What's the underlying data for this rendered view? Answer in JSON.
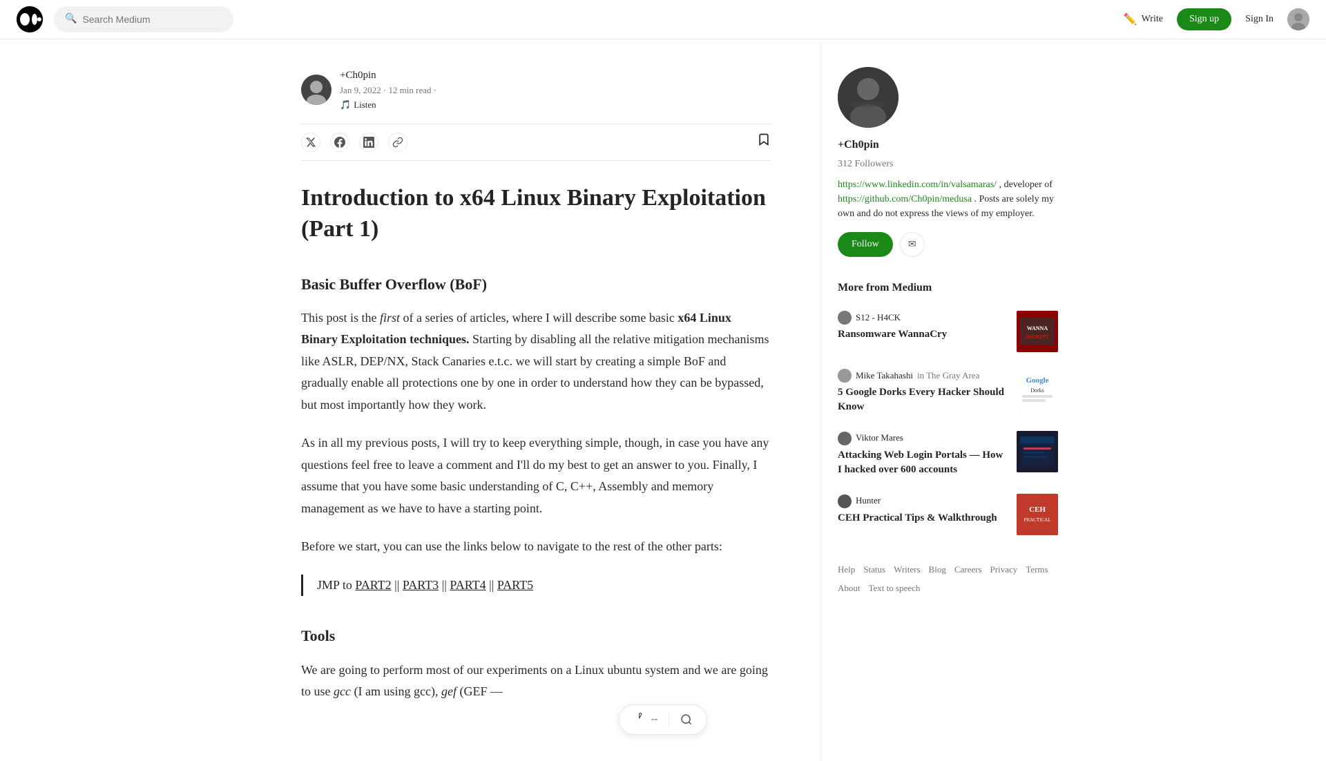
{
  "header": {
    "logo_letter": "M",
    "search_placeholder": "Search Medium",
    "write_label": "Write",
    "signup_label": "Sign up",
    "signin_label": "Sign In"
  },
  "article": {
    "author_name": "+Ch0pin",
    "date": "Jan 9, 2022",
    "read_time": "12 min read",
    "listen_label": "Listen",
    "title": "Introduction to x64 Linux Binary Exploitation (Part 1)",
    "section1_title": "Basic Buffer Overflow (BoF)",
    "para1": "This post is the first of a series of articles, where I will describe some basic x64 Linux Binary Exploitation techniques. Starting by disabling all the relative mitigation mechanisms like ASLR, DEP/NX, Stack Canaries e.t.c. we will start by creating a simple BoF and gradually enable all protections one by one in order to understand how they can be bypassed, but most importantly how they work.",
    "para2": "As in all my previous posts, I will try to keep everything simple, though, in case you have any questions feel free to leave a comment and I'll do my best to get an answer to you. Finally, I assume that you have some basic understanding of C, C++, Assembly and memory management as we have to have a starting point.",
    "para3": "Before we start, you can use the links below to navigate to the rest of the other parts:",
    "jmp_prefix": "JMP to",
    "part2_label": "PART2",
    "part2_sep1": " || ",
    "part3_label": "PART3",
    "part3_sep": " || ",
    "part4_label": "PART4",
    "part4_sep": " || ",
    "part5_label": "PART5",
    "section2_title": "Tools",
    "para4": "We are going to perform most of our experiments on a Linux ubuntu system and we are going to use gcc (I am using gcc), gef (GEF —"
  },
  "sidebar": {
    "author": {
      "name": "+Ch0pin",
      "followers": "312 Followers",
      "bio_link1": "https://www.linkedin.com/in/valsamaras/",
      "bio_text": ", developer of",
      "bio_link2": "https://github.com/Ch0pin/medusa",
      "bio_text2": ". Posts are solely my own and do not express the views of my employer.",
      "follow_label": "Follow",
      "subscribe_icon": "✉"
    },
    "more_from_medium_title": "More from Medium",
    "recommendations": [
      {
        "author_name": "S12 - H4CK",
        "in_label": "",
        "article_title": "Ransomware WannaCry",
        "thumb_type": "ransomware"
      },
      {
        "author_name": "Mike Takahashi",
        "in_label": "in The Gray Area",
        "article_title": "5 Google Dorks Every Hacker Should Know",
        "thumb_type": "google"
      },
      {
        "author_name": "Viktor Mares",
        "in_label": "",
        "article_title": "Attacking Web Login Portals — How I hacked over 600 accounts",
        "thumb_type": "web"
      },
      {
        "author_name": "Hunter",
        "in_label": "",
        "article_title": "CEH Practical Tips & Walkthrough",
        "thumb_type": "ceh"
      }
    ],
    "footer_links": [
      "Help",
      "Status",
      "Writers",
      "Blog",
      "Careers",
      "Privacy",
      "Terms",
      "About",
      "Text to speech"
    ]
  },
  "bottom_toolbar": {
    "clap_icon": "👏",
    "clap_label": "--",
    "search_icon": "🔍"
  }
}
